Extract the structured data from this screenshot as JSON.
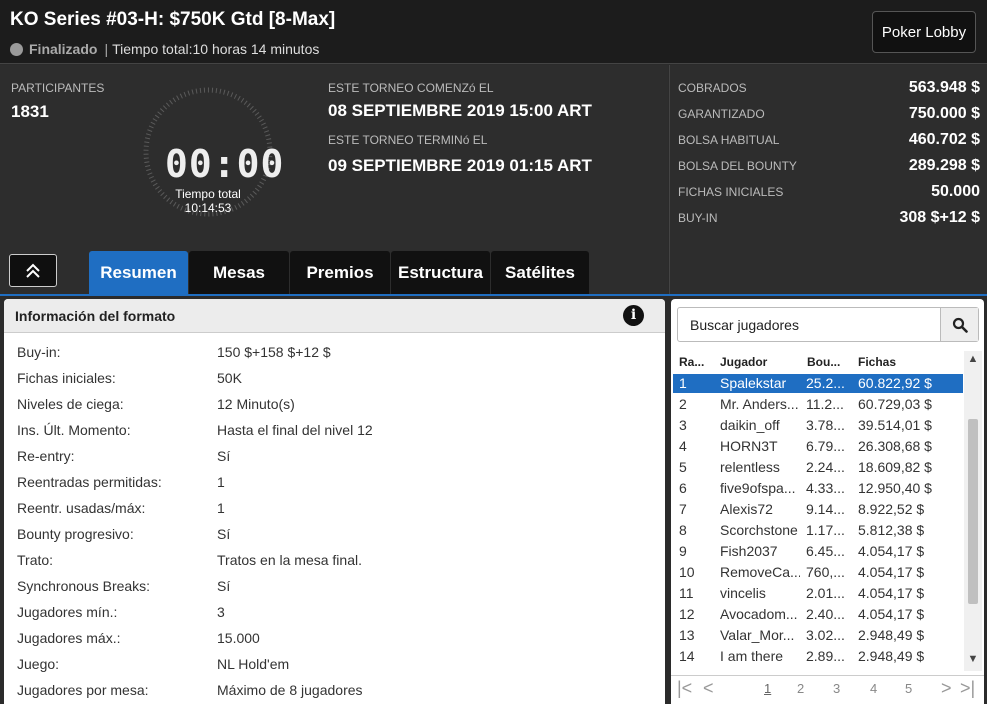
{
  "header": {
    "title": "KO Series #03-H: $750K Gtd [8-Max]",
    "status": "Finalizado",
    "total_time": "Tiempo total:10 horas  14 minutos",
    "lobby_button": "Poker Lobby"
  },
  "summary": {
    "participants_label": "PARTICIPANTES",
    "participants_value": "1831",
    "clock_display": "00:00",
    "clock_label": "Tiempo total",
    "clock_value": "10:14:53",
    "start_label": "ESTE TORNEO COMENZó EL",
    "start_value": "08 SEPTIEMBRE 2019  15:00 ART",
    "end_label": "ESTE TORNEO TERMINó EL",
    "end_value": "09 SEPTIEMBRE 2019  01:15 ART"
  },
  "prize": [
    {
      "label": "COBRADOS",
      "value": "563.948 $"
    },
    {
      "label": "GARANTIZADO",
      "value": "750.000 $"
    },
    {
      "label": "BOLSA HABITUAL",
      "value": "460.702 $"
    },
    {
      "label": "BOLSA DEL BOUNTY",
      "value": "289.298 $"
    },
    {
      "label": "FICHAS INICIALES",
      "value": "50.000"
    },
    {
      "label": "BUY-IN",
      "value": "308 $+12 $"
    }
  ],
  "tabs": [
    "Resumen",
    "Mesas",
    "Premios",
    "Estructura",
    "Satélites"
  ],
  "format": {
    "title": "Información del formato",
    "info_glyph": "i",
    "rows": [
      {
        "k": "Buy-in:",
        "v": "150 $+158 $+12 $"
      },
      {
        "k": "Fichas iniciales:",
        "v": "50K"
      },
      {
        "k": "Niveles de ciega:",
        "v": "12 Minuto(s)"
      },
      {
        "k": "Ins. Últ. Momento:",
        "v": "Hasta el final del nivel 12"
      },
      {
        "k": "Re-entry:",
        "v": "Sí"
      },
      {
        "k": "Reentradas permitidas:",
        "v": "1"
      },
      {
        "k": "Reentr. usadas/máx:",
        "v": "1"
      },
      {
        "k": "Bounty progresivo:",
        "v": "Sí"
      },
      {
        "k": "Trato:",
        "v": "Tratos en la mesa final."
      },
      {
        "k": "Synchronous Breaks:",
        "v": "Sí"
      },
      {
        "k": "Jugadores mín.:",
        "v": "3"
      },
      {
        "k": "Jugadores máx.:",
        "v": "15.000"
      },
      {
        "k": "Juego:",
        "v": "NL Hold'em"
      },
      {
        "k": "Jugadores por mesa:",
        "v": "Máximo de 8 jugadores"
      }
    ]
  },
  "players": {
    "search_placeholder": "Buscar jugadores",
    "columns": {
      "rank": "Ra...",
      "player": "Jugador",
      "bounty": "Bou...",
      "chips": "Fichas"
    },
    "rows": [
      {
        "rank": "1",
        "player": "Spalekstar",
        "bounty": "25.2...",
        "chips": "60.822,92 $"
      },
      {
        "rank": "2",
        "player": "Mr. Anders...",
        "bounty": "11.2...",
        "chips": "60.729,03 $"
      },
      {
        "rank": "3",
        "player": "daikin_off",
        "bounty": "3.78...",
        "chips": "39.514,01 $"
      },
      {
        "rank": "4",
        "player": "HORN3T",
        "bounty": "6.79...",
        "chips": "26.308,68 $"
      },
      {
        "rank": "5",
        "player": "relentless",
        "bounty": "2.24...",
        "chips": "18.609,82 $"
      },
      {
        "rank": "6",
        "player": "five9ofspa...",
        "bounty": "4.33...",
        "chips": "12.950,40 $"
      },
      {
        "rank": "7",
        "player": "Alexis72",
        "bounty": "9.14...",
        "chips": "8.922,52 $"
      },
      {
        "rank": "8",
        "player": "Scorchstone",
        "bounty": "1.17...",
        "chips": "5.812,38 $"
      },
      {
        "rank": "9",
        "player": "Fish2037",
        "bounty": "6.45...",
        "chips": "4.054,17 $"
      },
      {
        "rank": "10",
        "player": "RemoveCa...",
        "bounty": "760,...",
        "chips": "4.054,17 $"
      },
      {
        "rank": "11",
        "player": "vincelis",
        "bounty": "2.01...",
        "chips": "4.054,17 $"
      },
      {
        "rank": "12",
        "player": "Avocadom...",
        "bounty": "2.40...",
        "chips": "4.054,17 $"
      },
      {
        "rank": "13",
        "player": "Valar_Mor...",
        "bounty": "3.02...",
        "chips": "2.948,49 $"
      },
      {
        "rank": "14",
        "player": "I am there",
        "bounty": "2.89...",
        "chips": "2.948,49 $"
      }
    ],
    "pages": [
      "1",
      "2",
      "3",
      "4",
      "5"
    ],
    "current_page": "1"
  },
  "colors": {
    "accent": "#1f6ec2",
    "header_bg": "#1c1c1c",
    "panel_bg": "#2d2d2d"
  }
}
